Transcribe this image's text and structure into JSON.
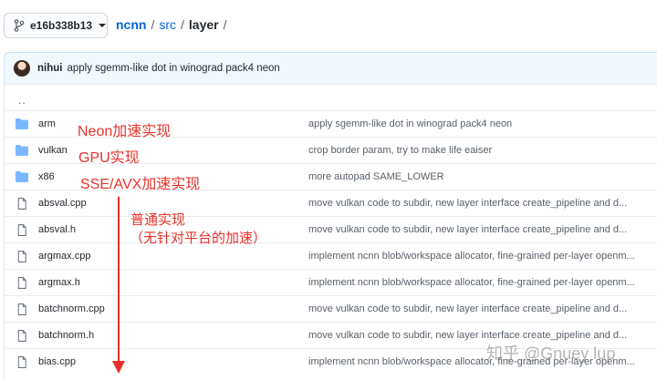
{
  "nav": {
    "branch": "e16b338b13",
    "repo": "ncnn",
    "sep1": "/",
    "path1": "src",
    "sep2": "/",
    "path2": "layer",
    "sep3": "/"
  },
  "commit": {
    "author": "nihui",
    "message": "apply sgemm-like dot in winograd pack4 neon"
  },
  "files": {
    "parent": "..",
    "rows": [
      {
        "name": "arm",
        "type": "dir",
        "commit": "apply sgemm-like dot in winograd pack4 neon"
      },
      {
        "name": "vulkan",
        "type": "dir",
        "commit": "crop border param, try to make life eaiser"
      },
      {
        "name": "x86",
        "type": "dir",
        "commit": "more autopad SAME_LOWER"
      },
      {
        "name": "absval.cpp",
        "type": "file",
        "commit": "move vulkan code to subdir, new layer interface create_pipeline and d..."
      },
      {
        "name": "absval.h",
        "type": "file",
        "commit": "move vulkan code to subdir, new layer interface create_pipeline and d..."
      },
      {
        "name": "argmax.cpp",
        "type": "file",
        "commit": "implement ncnn blob/workspace allocator, fine-grained per-layer openm..."
      },
      {
        "name": "argmax.h",
        "type": "file",
        "commit": "implement ncnn blob/workspace allocator, fine-grained per-layer openm..."
      },
      {
        "name": "batchnorm.cpp",
        "type": "file",
        "commit": "move vulkan code to subdir, new layer interface create_pipeline and d..."
      },
      {
        "name": "batchnorm.h",
        "type": "file",
        "commit": "move vulkan code to subdir, new layer interface create_pipeline and d..."
      },
      {
        "name": "bias.cpp",
        "type": "file",
        "commit": "implement ncnn blob/workspace allocator, fine-grained per-layer openm..."
      }
    ]
  },
  "annotations": {
    "neon": "Neon加速实现",
    "gpu": "GPU实现",
    "sse": "SSE/AVX加速实现",
    "plain": "普通实现",
    "plain_note": "（无针对平台的加速）"
  },
  "watermark": "知乎 @Gnuey lup",
  "colors": {
    "annotation": "#e8312a",
    "link": "#0366d6",
    "folder": "#79b8ff"
  }
}
